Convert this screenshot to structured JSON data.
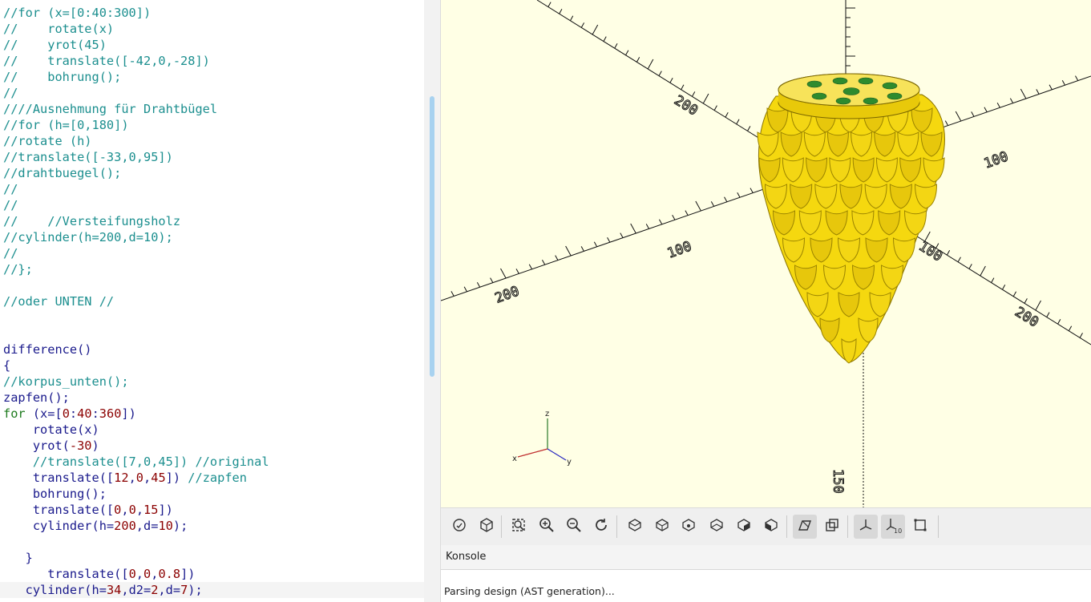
{
  "editor": {
    "lines": [
      {
        "segments": [
          {
            "t": "//for (x=[0:40:300])",
            "c": "comment"
          }
        ]
      },
      {
        "segments": [
          {
            "t": "//    rotate(x)",
            "c": "comment"
          }
        ]
      },
      {
        "segments": [
          {
            "t": "//    yrot(45)",
            "c": "comment"
          }
        ]
      },
      {
        "segments": [
          {
            "t": "//    translate([-42,0,-28])",
            "c": "comment"
          }
        ]
      },
      {
        "segments": [
          {
            "t": "//    bohrung();",
            "c": "comment"
          }
        ]
      },
      {
        "segments": [
          {
            "t": "//",
            "c": "comment"
          }
        ]
      },
      {
        "segments": [
          {
            "t": "////Ausnehmung für Drahtbügel",
            "c": "comment"
          }
        ]
      },
      {
        "segments": [
          {
            "t": "//for (h=[0,180])",
            "c": "comment"
          }
        ]
      },
      {
        "segments": [
          {
            "t": "//rotate (h)",
            "c": "comment"
          }
        ]
      },
      {
        "segments": [
          {
            "t": "//translate([-33,0,95])",
            "c": "comment"
          }
        ]
      },
      {
        "segments": [
          {
            "t": "//drahtbuegel();",
            "c": "comment"
          }
        ]
      },
      {
        "segments": [
          {
            "t": "//",
            "c": "comment"
          }
        ]
      },
      {
        "segments": [
          {
            "t": "//",
            "c": "comment"
          }
        ]
      },
      {
        "segments": [
          {
            "t": "//    //Versteifungsholz",
            "c": "comment"
          }
        ]
      },
      {
        "segments": [
          {
            "t": "//cylinder(h=200,d=10);",
            "c": "comment"
          }
        ]
      },
      {
        "segments": [
          {
            "t": "//",
            "c": "comment"
          }
        ]
      },
      {
        "segments": [
          {
            "t": "//};",
            "c": "comment"
          }
        ]
      },
      {
        "segments": []
      },
      {
        "segments": [
          {
            "t": "//oder UNTEN //",
            "c": "comment"
          }
        ]
      },
      {
        "segments": []
      },
      {
        "segments": []
      },
      {
        "segments": [
          {
            "t": "difference()",
            "c": "plain"
          }
        ]
      },
      {
        "segments": [
          {
            "t": "{",
            "c": "plain"
          }
        ]
      },
      {
        "segments": [
          {
            "t": "//korpus_unten();",
            "c": "comment"
          }
        ]
      },
      {
        "segments": [
          {
            "t": "zapfen();",
            "c": "plain"
          }
        ]
      },
      {
        "segments": [
          {
            "t": "for",
            "c": "kw"
          },
          {
            "t": " (x=[",
            "c": "plain"
          },
          {
            "t": "0",
            "c": "num"
          },
          {
            "t": ":",
            "c": "plain"
          },
          {
            "t": "40",
            "c": "num"
          },
          {
            "t": ":",
            "c": "plain"
          },
          {
            "t": "360",
            "c": "num"
          },
          {
            "t": "])",
            "c": "plain"
          }
        ]
      },
      {
        "segments": [
          {
            "t": "    rotate(x)",
            "c": "plain"
          }
        ]
      },
      {
        "segments": [
          {
            "t": "    yrot(",
            "c": "plain"
          },
          {
            "t": "-30",
            "c": "num"
          },
          {
            "t": ")",
            "c": "plain"
          }
        ]
      },
      {
        "segments": [
          {
            "t": "    //translate([7,0,45]) //original",
            "c": "comment"
          }
        ]
      },
      {
        "segments": [
          {
            "t": "    translate([",
            "c": "plain"
          },
          {
            "t": "12",
            "c": "num"
          },
          {
            "t": ",",
            "c": "plain"
          },
          {
            "t": "0",
            "c": "num"
          },
          {
            "t": ",",
            "c": "plain"
          },
          {
            "t": "45",
            "c": "num"
          },
          {
            "t": "]) ",
            "c": "plain"
          },
          {
            "t": "//zapfen",
            "c": "comment"
          }
        ]
      },
      {
        "segments": [
          {
            "t": "    bohrung();",
            "c": "plain"
          }
        ]
      },
      {
        "segments": [
          {
            "t": "    translate([",
            "c": "plain"
          },
          {
            "t": "0",
            "c": "num"
          },
          {
            "t": ",",
            "c": "plain"
          },
          {
            "t": "0",
            "c": "num"
          },
          {
            "t": ",",
            "c": "plain"
          },
          {
            "t": "15",
            "c": "num"
          },
          {
            "t": "])",
            "c": "plain"
          }
        ]
      },
      {
        "segments": [
          {
            "t": "    cylinder(h=",
            "c": "plain"
          },
          {
            "t": "200",
            "c": "num"
          },
          {
            "t": ",d=",
            "c": "plain"
          },
          {
            "t": "10",
            "c": "num"
          },
          {
            "t": ");",
            "c": "plain"
          }
        ]
      },
      {
        "segments": []
      },
      {
        "segments": [
          {
            "t": "   }",
            "c": "plain"
          }
        ]
      },
      {
        "segments": [
          {
            "t": "      translate([",
            "c": "plain"
          },
          {
            "t": "0",
            "c": "num"
          },
          {
            "t": ",",
            "c": "plain"
          },
          {
            "t": "0",
            "c": "num"
          },
          {
            "t": ",",
            "c": "plain"
          },
          {
            "t": "0.8",
            "c": "num"
          },
          {
            "t": "])",
            "c": "plain"
          }
        ]
      },
      {
        "segments": [
          {
            "t": "   cylinder(h=",
            "c": "plain"
          },
          {
            "t": "34",
            "c": "num"
          },
          {
            "t": ",d2=",
            "c": "plain"
          },
          {
            "t": "2",
            "c": "num"
          },
          {
            "t": ",d=",
            "c": "plain"
          },
          {
            "t": "7",
            "c": "num"
          },
          {
            "t": ");",
            "c": "plain"
          }
        ]
      }
    ]
  },
  "viewport": {
    "background_color": "#ffffe5",
    "model_color": "#f5d80f",
    "axis_labels": {
      "x": "x",
      "y": "y",
      "z": "z"
    },
    "ruler_numbers": [
      "200",
      "100",
      "100",
      "200",
      "100",
      "200",
      "100",
      "150"
    ]
  },
  "toolbar": {
    "buttons": [
      {
        "name": "preview-button",
        "icon": "preview-icon",
        "active": false
      },
      {
        "name": "render-button",
        "icon": "render-icon",
        "active": false
      },
      {
        "name": "view-all-button",
        "icon": "view-all-icon",
        "active": false
      },
      {
        "name": "zoom-in-button",
        "icon": "zoom-in-icon",
        "active": false
      },
      {
        "name": "zoom-out-button",
        "icon": "zoom-out-icon",
        "active": false
      },
      {
        "name": "reset-view-button",
        "icon": "reset-view-icon",
        "active": false
      },
      {
        "name": "view-right-button",
        "icon": "view-right-icon",
        "active": false
      },
      {
        "name": "view-top-button",
        "icon": "view-top-icon",
        "active": false
      },
      {
        "name": "view-bottom-button",
        "icon": "view-bottom-icon",
        "active": false
      },
      {
        "name": "view-left-button",
        "icon": "view-left-icon",
        "active": false
      },
      {
        "name": "view-front-button",
        "icon": "view-front-icon",
        "active": false
      },
      {
        "name": "view-back-button",
        "icon": "view-back-icon",
        "active": false
      },
      {
        "name": "perspective-button",
        "icon": "perspective-icon",
        "active": true
      },
      {
        "name": "orthogonal-button",
        "icon": "orthogonal-icon",
        "active": false
      },
      {
        "name": "show-axes-button",
        "icon": "axes-icon",
        "active": true
      },
      {
        "name": "show-scale-markers-button",
        "icon": "scale-markers-icon",
        "active": true
      },
      {
        "name": "show-edges-button",
        "icon": "edges-icon",
        "active": false
      }
    ]
  },
  "console": {
    "title": "Konsole",
    "messages": [
      "Parsing design (AST generation)..."
    ]
  }
}
